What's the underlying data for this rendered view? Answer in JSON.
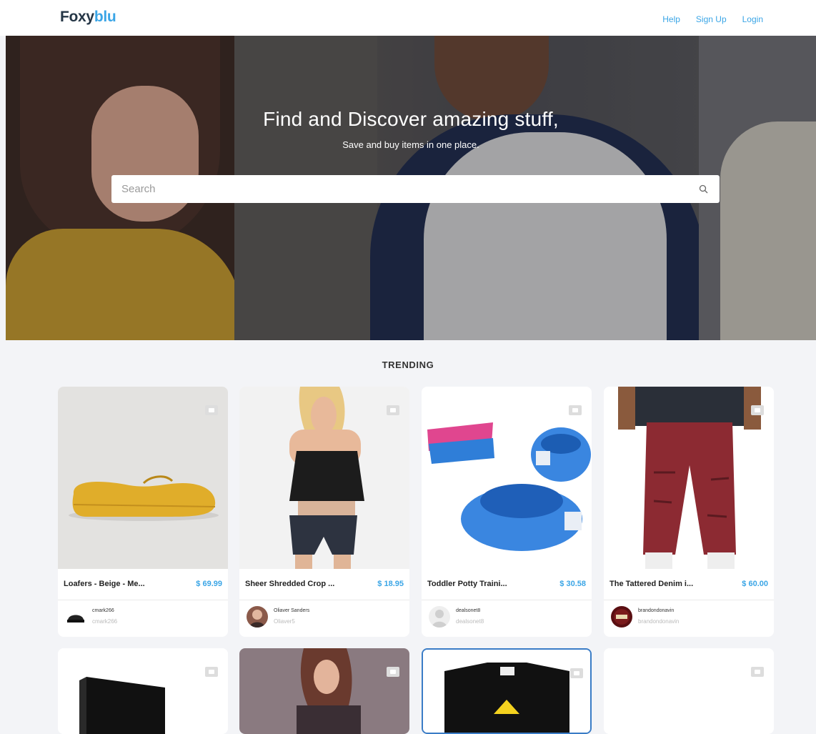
{
  "app": {
    "logo_part1": "Foxy",
    "logo_part2": "blu"
  },
  "nav": {
    "help": "Help",
    "signup": "Sign Up",
    "login": "Login"
  },
  "hero": {
    "title": "Find and Discover amazing stuff,",
    "subtitle": "Save and buy items in one place.",
    "search_placeholder": "Search"
  },
  "trending": {
    "title": "TRENDING",
    "items": [
      {
        "name": "Loafers - Beige - Me...",
        "price": "$ 69.99",
        "user": "cmark266",
        "handle": "cmark266"
      },
      {
        "name": "Sheer Shredded Crop ...",
        "price": "$ 18.95",
        "user": "Oliaver Sanders",
        "handle": "Oliaver5"
      },
      {
        "name": "Toddler Potty Traini...",
        "price": "$ 30.58",
        "user": "dealsonet8",
        "handle": "dealsonet8"
      },
      {
        "name": "The Tattered Denim i...",
        "price": "$ 60.00",
        "user": "brandondonavin",
        "handle": "brandondonavin"
      }
    ]
  },
  "colors": {
    "accent": "#3aa5e6",
    "logo_dark": "#253646",
    "page_bg": "#f3f4f7"
  },
  "icons": {
    "search": "search-icon",
    "favorite": "heart-icon"
  }
}
